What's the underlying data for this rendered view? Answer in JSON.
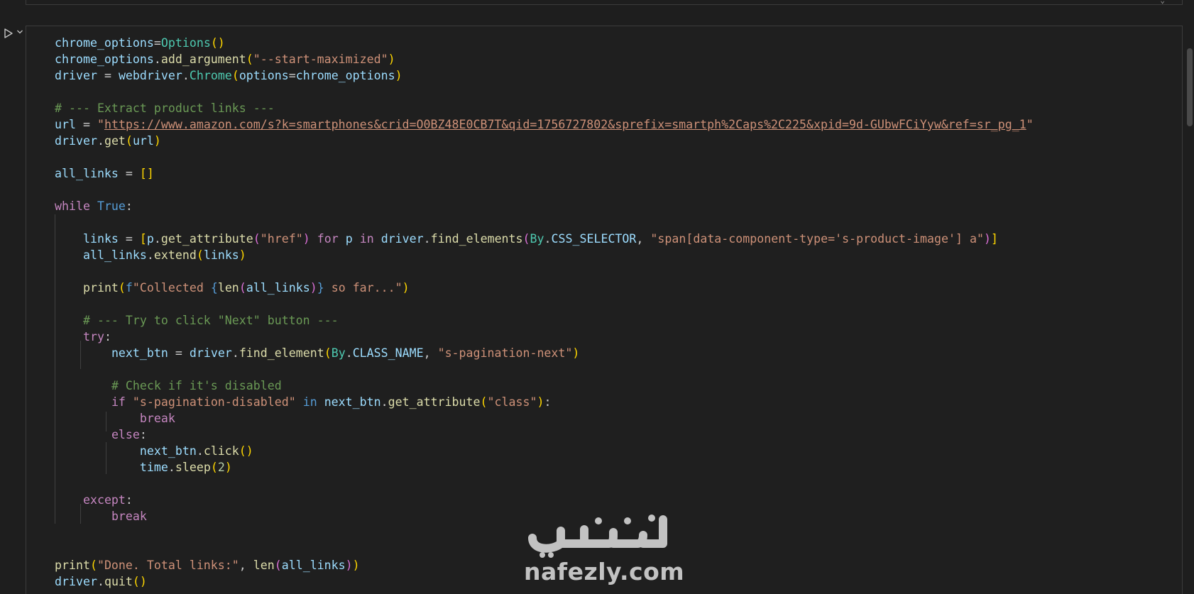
{
  "watermark": {
    "arabic": "نفذلي",
    "latin": "nafezly.com"
  },
  "run_icon": "play-icon",
  "expand_icon": "chevron-down-icon",
  "code_lines": [
    [
      [
        "vr",
        "chrome_options"
      ],
      [
        "",
        "="
      ],
      [
        "cl",
        "Options"
      ],
      [
        "p1",
        "()"
      ]
    ],
    [
      [
        "vr",
        "chrome_options"
      ],
      [
        "",
        "."
      ],
      [
        "fn",
        "add_argument"
      ],
      [
        "p1",
        "("
      ],
      [
        "st",
        "\"--start-maximized\""
      ],
      [
        "p1",
        ")"
      ]
    ],
    [
      [
        "vr",
        "driver"
      ],
      [
        "",
        " = "
      ],
      [
        "vr",
        "webdriver"
      ],
      [
        "",
        "."
      ],
      [
        "cl",
        "Chrome"
      ],
      [
        "p1",
        "("
      ],
      [
        "vr",
        "options"
      ],
      [
        "",
        "="
      ],
      [
        "vr",
        "chrome_options"
      ],
      [
        "p1",
        ")"
      ]
    ],
    [],
    [
      [
        "cm",
        "# --- Extract product links ---"
      ]
    ],
    [
      [
        "vr",
        "url"
      ],
      [
        "",
        " = "
      ],
      [
        "st",
        "\""
      ],
      [
        "st url",
        "https://www.amazon.com/s?k=smartphones&crid=O0BZ48E0CB7T&qid=1756727802&sprefix=smartph%2Caps%2C225&xpid=9d-GUbwFCiYyw&ref=sr_pg_1"
      ],
      [
        "st",
        "\""
      ]
    ],
    [
      [
        "vr",
        "driver"
      ],
      [
        "",
        "."
      ],
      [
        "fn",
        "get"
      ],
      [
        "p1",
        "("
      ],
      [
        "vr",
        "url"
      ],
      [
        "p1",
        ")"
      ]
    ],
    [],
    [
      [
        "vr",
        "all_links"
      ],
      [
        "",
        " = "
      ],
      [
        "p1",
        "[]"
      ]
    ],
    [],
    [
      [
        "kw",
        "while"
      ],
      [
        "",
        " "
      ],
      [
        "kb",
        "True"
      ],
      [
        "",
        ":"
      ]
    ],
    [],
    [
      [
        "",
        "    "
      ],
      [
        "vr",
        "links"
      ],
      [
        "",
        " = "
      ],
      [
        "p1",
        "["
      ],
      [
        "vr",
        "p"
      ],
      [
        "",
        "."
      ],
      [
        "fn",
        "get_attribute"
      ],
      [
        "p2",
        "("
      ],
      [
        "st",
        "\"href\""
      ],
      [
        "p2",
        ")"
      ],
      [
        "",
        " "
      ],
      [
        "kw",
        "for"
      ],
      [
        "",
        " "
      ],
      [
        "vr",
        "p"
      ],
      [
        "",
        " "
      ],
      [
        "kw",
        "in"
      ],
      [
        "",
        " "
      ],
      [
        "vr",
        "driver"
      ],
      [
        "",
        "."
      ],
      [
        "fn",
        "find_elements"
      ],
      [
        "p2",
        "("
      ],
      [
        "cl",
        "By"
      ],
      [
        "",
        "."
      ],
      [
        "vr",
        "CSS_SELECTOR"
      ],
      [
        "",
        ", "
      ],
      [
        "st",
        "\"span[data-component-type='s-product-image'] a\""
      ],
      [
        "p2",
        ")"
      ],
      [
        "p1",
        "]"
      ]
    ],
    [
      [
        "",
        "    "
      ],
      [
        "vr",
        "all_links"
      ],
      [
        "",
        "."
      ],
      [
        "fn",
        "extend"
      ],
      [
        "p1",
        "("
      ],
      [
        "vr",
        "links"
      ],
      [
        "p1",
        ")"
      ]
    ],
    [],
    [
      [
        "",
        "    "
      ],
      [
        "fn",
        "print"
      ],
      [
        "p1",
        "("
      ],
      [
        "kb",
        "f"
      ],
      [
        "st",
        "\"Collected "
      ],
      [
        "kb",
        "{"
      ],
      [
        "fn",
        "len"
      ],
      [
        "p2",
        "("
      ],
      [
        "vr",
        "all_links"
      ],
      [
        "p2",
        ")"
      ],
      [
        "kb",
        "}"
      ],
      [
        "st",
        " so far...\""
      ],
      [
        "p1",
        ")"
      ]
    ],
    [],
    [
      [
        "",
        "    "
      ],
      [
        "cm",
        "# --- Try to click \"Next\" button ---"
      ]
    ],
    [
      [
        "",
        "    "
      ],
      [
        "kw",
        "try"
      ],
      [
        "",
        ":"
      ]
    ],
    [
      [
        "",
        "        "
      ],
      [
        "vr",
        "next_btn"
      ],
      [
        "",
        " = "
      ],
      [
        "vr",
        "driver"
      ],
      [
        "",
        "."
      ],
      [
        "fn",
        "find_element"
      ],
      [
        "p1",
        "("
      ],
      [
        "cl",
        "By"
      ],
      [
        "",
        "."
      ],
      [
        "vr",
        "CLASS_NAME"
      ],
      [
        "",
        ", "
      ],
      [
        "st",
        "\"s-pagination-next\""
      ],
      [
        "p1",
        ")"
      ]
    ],
    [],
    [
      [
        "",
        "        "
      ],
      [
        "cm",
        "# Check if it's disabled"
      ]
    ],
    [
      [
        "",
        "        "
      ],
      [
        "kw",
        "if"
      ],
      [
        "",
        " "
      ],
      [
        "st",
        "\"s-pagination-disabled\""
      ],
      [
        "",
        " "
      ],
      [
        "kb",
        "in"
      ],
      [
        "",
        " "
      ],
      [
        "vr",
        "next_btn"
      ],
      [
        "",
        "."
      ],
      [
        "fn",
        "get_attribute"
      ],
      [
        "p1",
        "("
      ],
      [
        "st",
        "\"class\""
      ],
      [
        "p1",
        ")"
      ],
      [
        "",
        ":"
      ]
    ],
    [
      [
        "",
        "            "
      ],
      [
        "kw",
        "break"
      ]
    ],
    [
      [
        "",
        "        "
      ],
      [
        "kw",
        "else"
      ],
      [
        "",
        ":"
      ]
    ],
    [
      [
        "",
        "            "
      ],
      [
        "vr",
        "next_btn"
      ],
      [
        "",
        "."
      ],
      [
        "fn",
        "click"
      ],
      [
        "p1",
        "()"
      ]
    ],
    [
      [
        "",
        "            "
      ],
      [
        "vr",
        "time"
      ],
      [
        "",
        "."
      ],
      [
        "fn",
        "sleep"
      ],
      [
        "p1",
        "("
      ],
      [
        "nm",
        "2"
      ],
      [
        "p1",
        ")"
      ]
    ],
    [],
    [
      [
        "",
        "    "
      ],
      [
        "kw",
        "except"
      ],
      [
        "",
        ":"
      ]
    ],
    [
      [
        "",
        "        "
      ],
      [
        "kw",
        "break"
      ]
    ],
    [],
    [],
    [
      [
        "fn",
        "print"
      ],
      [
        "p1",
        "("
      ],
      [
        "st",
        "\"Done. Total links:\""
      ],
      [
        "",
        ", "
      ],
      [
        "fn",
        "len"
      ],
      [
        "p2",
        "("
      ],
      [
        "vr",
        "all_links"
      ],
      [
        "p2",
        ")"
      ],
      [
        "p1",
        ")"
      ]
    ],
    [
      [
        "vr",
        "driver"
      ],
      [
        "",
        "."
      ],
      [
        "fn",
        "quit"
      ],
      [
        "p1",
        "()"
      ]
    ]
  ]
}
